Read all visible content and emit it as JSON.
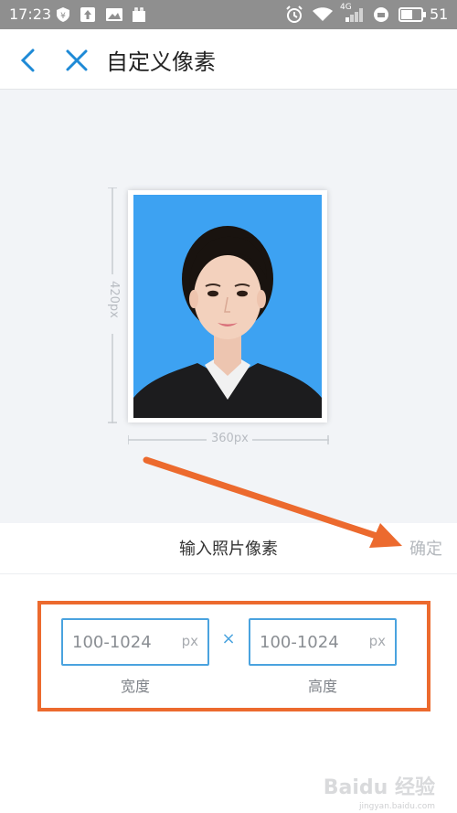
{
  "status_bar": {
    "time": "17:23",
    "battery": "51",
    "signal_label": "4G"
  },
  "header": {
    "title": "自定义像素"
  },
  "preview": {
    "height_label": "420px",
    "width_label": "360px",
    "photo_background": "#3da2f2"
  },
  "input_section": {
    "label": "输入照片像素",
    "confirm": "确定",
    "width": {
      "placeholder": "100-1024",
      "unit": "px",
      "label": "宽度"
    },
    "separator": "×",
    "height": {
      "placeholder": "100-1024",
      "unit": "px",
      "label": "高度"
    }
  },
  "colors": {
    "accent": "#4aa3df",
    "annotation": "#ec6a2e"
  },
  "watermark": {
    "text": "Baidu 经验",
    "sub": "jingyan.baidu.com"
  }
}
